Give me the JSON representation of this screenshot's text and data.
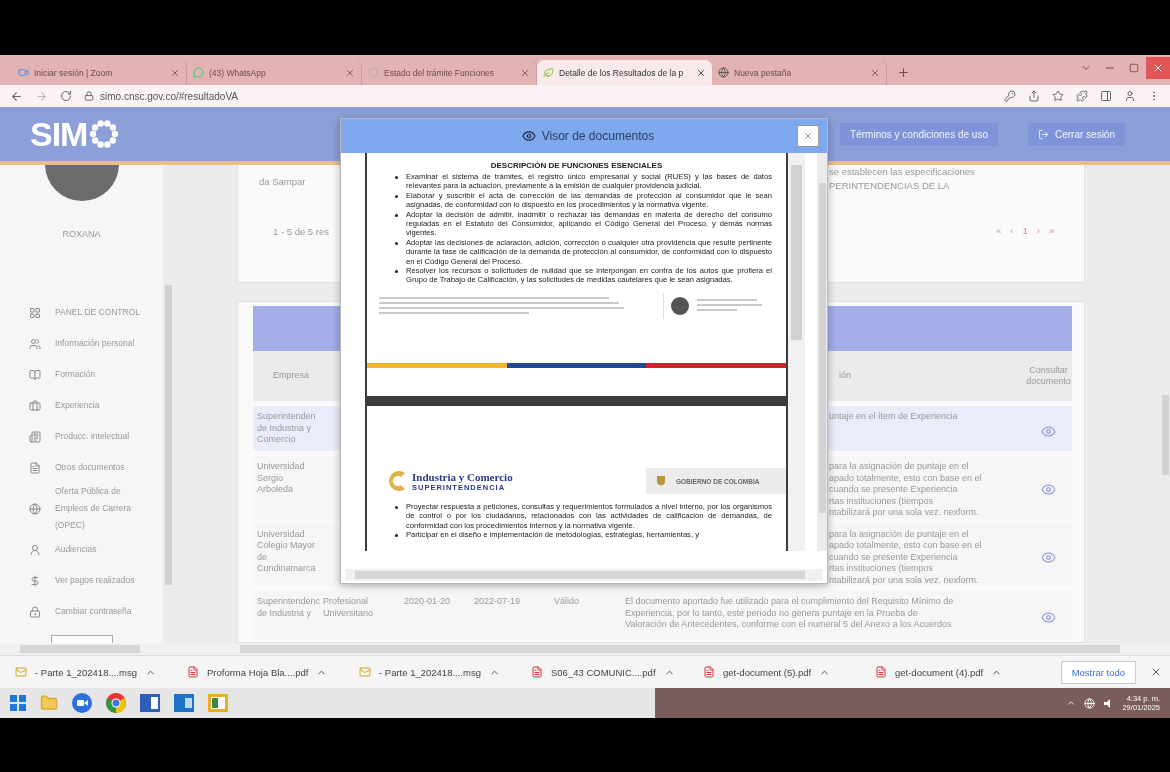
{
  "browser": {
    "tabs": [
      {
        "title": "Iniciar sesión | Zoom",
        "selected": false,
        "kind": "video"
      },
      {
        "title": "(43) WhatsApp",
        "selected": false,
        "kind": "chat"
      },
      {
        "title": "Estado del trámite Funciones",
        "selected": false,
        "kind": "shield"
      },
      {
        "title": "Detalle de los Resultados de la p",
        "selected": true,
        "kind": "leaf"
      },
      {
        "title": "Nueva pestaña",
        "selected": false,
        "kind": "globe"
      }
    ],
    "address": "simo.cnsc.gov.co/#resultadoVA"
  },
  "header": {
    "logo": "SIM",
    "buttons": [
      {
        "label": "Términos y condiciones de uso",
        "kind": "plain"
      },
      {
        "label": "Cerrar sesión",
        "kind": "logout"
      }
    ]
  },
  "sidebar": {
    "user": "ROXANA",
    "items": [
      {
        "label": "PANEL DE CONTROL",
        "kind": "grid"
      },
      {
        "label": "Información personal",
        "kind": "people"
      },
      {
        "label": "Formación",
        "kind": "book"
      },
      {
        "label": "Experiencia",
        "kind": "briefcase"
      },
      {
        "label": "Producc. intelectual",
        "kind": "news"
      },
      {
        "label": "Otros documentos",
        "kind": "file"
      },
      {
        "label": "Oferta Pública de\nEmpleos de Carrera (OPEC)",
        "kind": "globe"
      },
      {
        "label": "Audiencias",
        "kind": "person"
      },
      {
        "label": "Ver pagos realizados",
        "kind": "money"
      },
      {
        "label": "Cambiar contraseña",
        "kind": "lock"
      }
    ]
  },
  "summary": {
    "left": "da Sampar",
    "right": "se establecen las especificaciones\nPERINTENDENCIAS DE LA",
    "count": "1 - 5 de 5 res",
    "pagination": [
      "«",
      "‹",
      "1",
      "›",
      "»"
    ]
  },
  "table": {
    "columns": [
      "Empresa",
      "ión",
      "Consultar documento"
    ],
    "rows": [
      {
        "kind": "covered",
        "selected": true,
        "company": "Superintenden\nde Industria y\nComercio",
        "description": "untaje en el ítem de Experiencia"
      },
      {
        "kind": "covered",
        "selected": false,
        "company": "Universidad\nSergio\nArboleda",
        "description": "para la asignación de puntaje en el\napado totalmente, esto con base en el\ncuando se presente Experiencia\nrtas instituciones (tiempos\nntabilizará por una sola vez. nexform."
      },
      {
        "kind": "covered",
        "selected": false,
        "company": "Universidad\nColegio Mayor\nde\nCundinamarca",
        "description": "para la asignación de puntaje en el\napado totalmente, esto con base en el\ncuando se presente Experiencia\nrtas instituciones (tiempos\nntabilizará por una sola vez. nexform."
      },
      {
        "kind": "full",
        "selected": false,
        "company": "Superintendenc\nde Industria y",
        "cells": [
          "Profesional\nUniversitario",
          "2020-01-20",
          "2022-07-19",
          "Válido"
        ],
        "description": "El documento aportado fue utilizado para el cumplimiento del Requisito Mínimo de\nExperiencia, por lo tanto, este periodo no genera puntaje en la Prueba de\nValoración de Antecedentes, conforme con el numeral 5 del Anexo a los Acuerdos"
      }
    ]
  },
  "viewer": {
    "title": "Visor de documentos",
    "pages": [
      {
        "kind": "functions",
        "heading": "DESCRIPCIÓN DE FUNCIONES ESENCIALES",
        "bullets": [
          "Examinar el sistema de trámites, el registro único empresarial y social (RUES) y las bases de datos relevantes para la actuación, previamente a la emisión de cualquier providencia judicial.",
          "Elaborar y suscribir el acta de corrección de las demandas de protección al consumidor que le sean asignadas, de conformidad con lo dispuesto en los procedimientos y la normativa vigente.",
          "Adoptar la decisión de admitir, inadmitir o rechazar las demandas en materia de derecho del consumo reguladas en el Estatuto del Consumidor, aplicando el Código General del Proceso, y demás normas vigentes.",
          "Adoptar las decisiones de aclaración, adición, corrección o cualquier otra providencia que resulte pertinente durante la fase de calificación de la demanda de protección al consumidor, de conformidad con lo dispuesto en el Código General del Proceso.",
          "Resolver los recursos o solicitudes de nulidad que se interpongan en contra de los autos que profiera el Grupo de Trabajo de Calificación, y las solicitudes de medidas cautelares que le sean asignadas."
        ]
      },
      {
        "kind": "letterhead",
        "brand": "Industria y Comercio",
        "brand_sub": "SUPERINTENDENCIA",
        "government": "GOBIERNO DE COLOMBIA",
        "bullets": [
          "Proyectar respuesta a peticiones, consultas y requerimientos formulados a nivel interno, por los organismos de control o por los ciudadanos, relacionados con las actividades de calificación de demandas, de conformidad con los procedimientos internos y la normativa vigente.",
          "Participar en el diseño e implementación de metodologías, estrategias, herramientas, y"
        ]
      }
    ]
  },
  "downloads": {
    "items": [
      {
        "name": "- Parte 1_202418....msg",
        "kind": "msg"
      },
      {
        "name": "Proforma Hoja Bla....pdf",
        "kind": "pdf"
      },
      {
        "name": "- Parte 1_202418....msg",
        "kind": "msg"
      },
      {
        "name": "S06_43 COMUNIC....pdf",
        "kind": "pdf"
      },
      {
        "name": "get-document (5).pdf",
        "kind": "pdf"
      },
      {
        "name": "get-document (4).pdf",
        "kind": "pdf"
      }
    ],
    "show_all": "Mostrar todo"
  },
  "taskbar": {
    "time": "4:34 p. m.",
    "date": "29/01/2025"
  }
}
